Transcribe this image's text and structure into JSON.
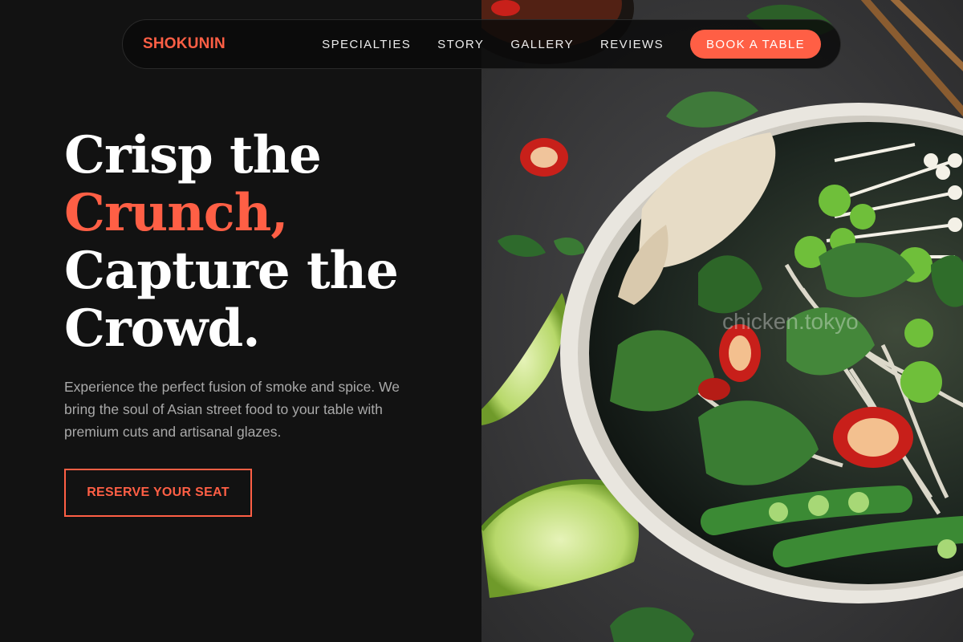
{
  "nav": {
    "brand": "SHOKUNIN",
    "links": [
      "SPECIALTIES",
      "STORY",
      "GALLERY",
      "REVIEWS"
    ],
    "cta": "BOOK A TABLE"
  },
  "hero": {
    "headline_line1": "Crisp the",
    "headline_line2": "Crunch,",
    "headline_line3": "Capture the",
    "headline_line4": "Crowd.",
    "description": "Experience the perfect fusion of smoke and spice. We bring the soul of Asian street food to your table with premium cuts and artisanal glazes.",
    "cta": "RESERVE YOUR SEAT"
  },
  "image": {
    "watermark": "chicken.tokyo"
  },
  "colors": {
    "background": "#121212",
    "accent": "#ff5f45",
    "text": "#ffffff",
    "muted_text": "#a9a9a9"
  }
}
